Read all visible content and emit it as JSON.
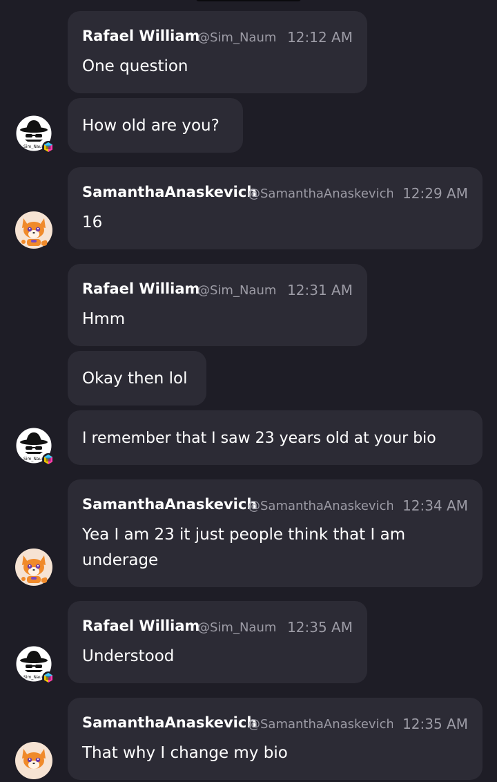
{
  "messages": [
    {
      "name": "Rafael William",
      "handle": "@Sim_Naum",
      "time": "12:12 AM",
      "text": "One question"
    },
    {
      "text": "How old are you?"
    },
    {
      "name": "SamanthaAnaskevich",
      "handle": "@SamanthaAnaskevich",
      "time": "12:29 AM",
      "text": "16"
    },
    {
      "name": "Rafael William",
      "handle": "@Sim_Naum",
      "time": "12:31 AM",
      "text": "Hmm"
    },
    {
      "text": "Okay then lol"
    },
    {
      "text": "I remember that I saw 23 years old at your bio"
    },
    {
      "name": "SamanthaAnaskevich",
      "handle": "@SamanthaAnaskevich",
      "time": "12:34 AM",
      "text": "Yea I am 23 it just people think that I am underage"
    },
    {
      "name": "Rafael William",
      "handle": "@Sim_Naum",
      "time": "12:35 AM",
      "text": "Understood"
    },
    {
      "name": "SamanthaAnaskevich",
      "handle": "@SamanthaAnaskevich",
      "time": "12:35 AM",
      "text": "That why I change my bio"
    }
  ],
  "avatars": {
    "rafael": {
      "icon": "hat-glasses-avatar-icon",
      "caption": "Sim_Nau",
      "badge": "cube-badge-icon"
    },
    "samantha": {
      "icon": "fox-avatar-icon"
    }
  },
  "colors": {
    "background": "#1e1d26",
    "bubble": "#2c2b35",
    "secondary_text": "#9c9ba5",
    "primary_text": "#ffffff"
  }
}
